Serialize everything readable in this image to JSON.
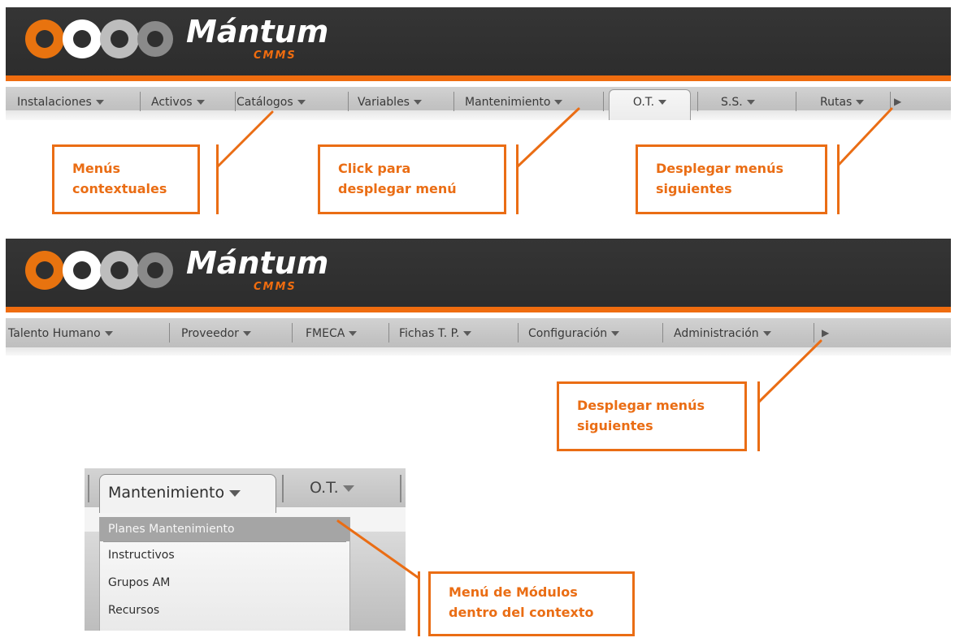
{
  "app": {
    "logo_word": "Mántum",
    "logo_sub": "CMMS"
  },
  "menu1": {
    "items": [
      "Instalaciones",
      "Activos",
      "Catálogos",
      "Variables",
      "Mantenimiento",
      "O.T.",
      "S.S.",
      "Rutas"
    ],
    "active": "O.T.",
    "next_icon": "next-menus-icon"
  },
  "menu2": {
    "items": [
      "Talento Humano",
      "Proveedor",
      "FMECA",
      "Fichas T. P.",
      "Configuración",
      "Administración"
    ],
    "next_icon": "next-menus-icon"
  },
  "callouts": {
    "contextual": [
      "Menús",
      "contextuales"
    ],
    "click": [
      "Click para",
      "desplegar menú"
    ],
    "next_top": [
      "Desplegar menús",
      "siguientes"
    ],
    "next_bottom": [
      "Desplegar menús",
      "siguientes"
    ],
    "modules": [
      "Menú de Módulos",
      "dentro del contexto"
    ]
  },
  "dropdown": {
    "tab_label": "Mantenimiento",
    "next_tab_label": "O.T.",
    "items": [
      "Planes Mantenimiento",
      "Instructivos",
      "Grupos AM",
      "Recursos"
    ],
    "highlighted_index": 0
  },
  "colors": {
    "accent": "#ea6d14",
    "banner": "#2f2f2f",
    "menubar": "#c4c4c4"
  }
}
